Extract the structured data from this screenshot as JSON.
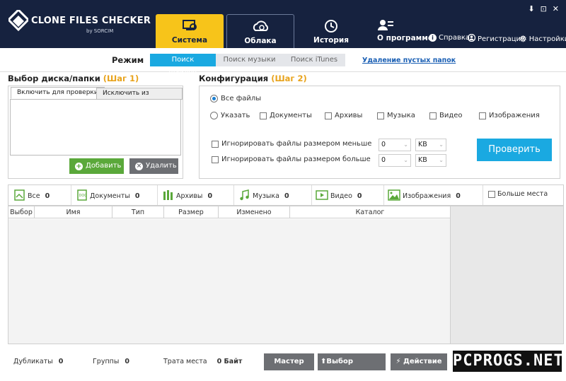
{
  "app": {
    "title": "CLONE FILES CHECKER",
    "subtitle": "by SORCIM"
  },
  "window_controls": {
    "pin": "⬇",
    "restore": "⊡",
    "close": "✕"
  },
  "nav": {
    "tabs": [
      {
        "label": "Система",
        "icon": "system-icon",
        "active": true
      },
      {
        "label": "Облака",
        "icon": "cloud-icon",
        "active": false
      },
      {
        "label": "История",
        "icon": "history-icon",
        "active": false
      }
    ],
    "about": "О программе",
    "help": "Справка",
    "register": "Регистрация",
    "settings": "Настройки"
  },
  "mode": {
    "label": "Режим",
    "tabs": [
      "Поиск файлов",
      "Поиск музыки",
      "Поиск iTunes"
    ],
    "active_index": 0,
    "link": "Удаление пустых папок"
  },
  "drive": {
    "title": "Выбор диска/папки",
    "step": "(Шаг 1)",
    "tab_include": "Включить для проверки",
    "tab_exclude": "Исключить из проверки",
    "add": "Добавить",
    "remove": "Удалить"
  },
  "config": {
    "title": "Конфигурация",
    "step": "(Шаг 2)",
    "all_files": "Все файлы",
    "specify": "Указать",
    "types": [
      "Документы",
      "Архивы",
      "Музыка",
      "Видео",
      "Изображения"
    ],
    "ignore_smaller": "Игнорировать файлы размером меньше",
    "ignore_larger": "Игнорировать файлы размером больше",
    "smaller_value": "0",
    "smaller_unit": "KB",
    "larger_value": "0",
    "larger_unit": "KB",
    "check": "Проверить"
  },
  "filters": [
    {
      "label": "Все",
      "count": "0",
      "icon": "all-files-icon"
    },
    {
      "label": "Документы",
      "count": "0",
      "icon": "document-icon"
    },
    {
      "label": "Архивы",
      "count": "0",
      "icon": "archive-icon"
    },
    {
      "label": "Музыка",
      "count": "0",
      "icon": "music-icon"
    },
    {
      "label": "Видео",
      "count": "0",
      "icon": "video-icon"
    },
    {
      "label": "Изображения",
      "count": "0",
      "icon": "image-icon"
    }
  ],
  "more_space": "Больше места",
  "table": {
    "columns": [
      "Выбор",
      "Имя",
      "Тип",
      "Размер",
      "Изменено",
      "Каталог"
    ]
  },
  "status": {
    "duplicates_label": "Дубликаты",
    "duplicates": "0",
    "groups_label": "Группы",
    "groups": "0",
    "waste_label": "Трата места",
    "waste": "0 Байт",
    "master": "Мастер",
    "select": "Выбор",
    "action": "Действие"
  },
  "watermark": "PCPROGS.NET",
  "colors": {
    "header": "#16223f",
    "accent_yellow": "#f7c41a",
    "accent_blue": "#1aa9e1",
    "green": "#5aa83a",
    "step": "#e8a31c"
  }
}
